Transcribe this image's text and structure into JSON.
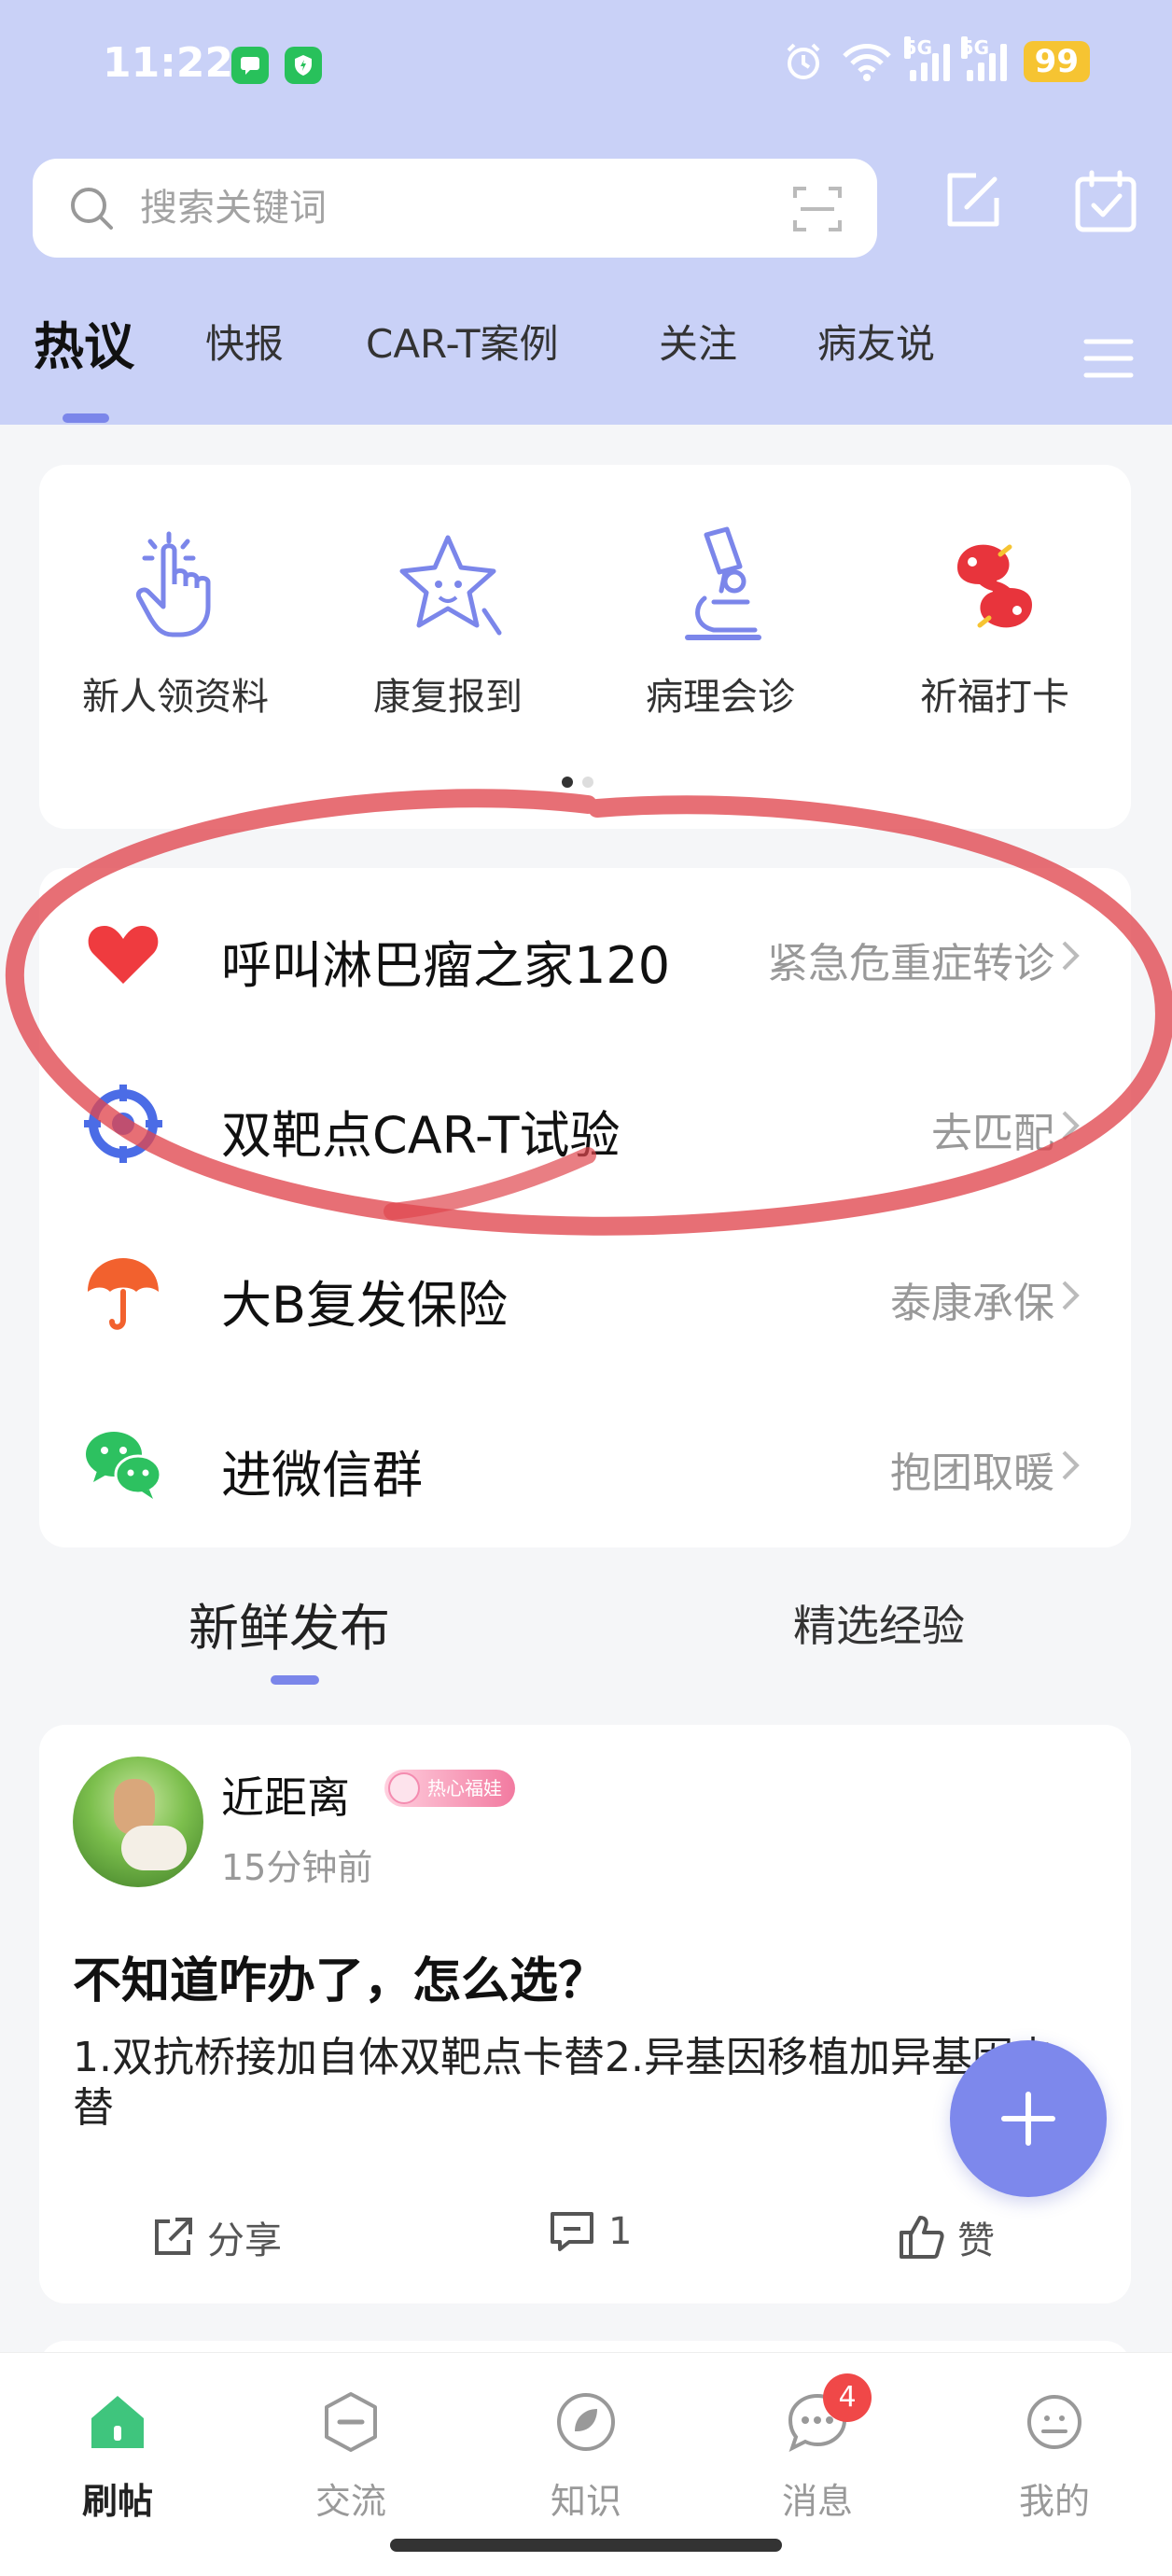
{
  "status_bar": {
    "time": "11:22",
    "network": [
      "5G",
      "5G"
    ],
    "battery": "99"
  },
  "header": {
    "search_placeholder": "搜索关键词",
    "tabs": [
      "热议",
      "快报",
      "CAR-T案例",
      "关注",
      "病友说"
    ]
  },
  "quick_actions": [
    {
      "label": "新人领资料",
      "icon": "hand-tap-icon"
    },
    {
      "label": "康复报到",
      "icon": "star-face-icon"
    },
    {
      "label": "病理会诊",
      "icon": "microscope-icon"
    },
    {
      "label": "祈福打卡",
      "icon": "koi-fish-icon"
    }
  ],
  "service_list": [
    {
      "title": "呼叫淋巴瘤之家120",
      "subtitle": "紧急危重症转诊",
      "icon": "heart-icon"
    },
    {
      "title": "双靶点CAR-T试验",
      "subtitle": "去匹配",
      "icon": "target-icon"
    },
    {
      "title": "大B复发保险",
      "subtitle": "泰康承保",
      "icon": "umbrella-icon"
    },
    {
      "title": "进微信群",
      "subtitle": "抱团取暖",
      "icon": "wechat-icon"
    }
  ],
  "feed_tabs": [
    "新鲜发布",
    "精选经验"
  ],
  "post": {
    "username": "近距离",
    "badge": "热心福娃",
    "time": "15分钟前",
    "title": "不知道咋办了，怎么选？",
    "body": "1.双抗桥接加自体双靶点卡替2.异基因移植加异基因卡替",
    "share_label": "分享",
    "comment_count": "1",
    "like_label": "赞"
  },
  "bottom_nav": [
    {
      "label": "刷帖",
      "icon": "home-icon",
      "active": true
    },
    {
      "label": "交流",
      "icon": "chat-minus-icon"
    },
    {
      "label": "知识",
      "icon": "leaf-icon"
    },
    {
      "label": "消息",
      "icon": "message-icon",
      "badge": "4"
    },
    {
      "label": "我的",
      "icon": "profile-icon"
    }
  ],
  "colors": {
    "header_bg": "#c9d1f7",
    "accent": "#7b86ea",
    "badge_red": "#f04848",
    "annotation": "#e0474e"
  }
}
